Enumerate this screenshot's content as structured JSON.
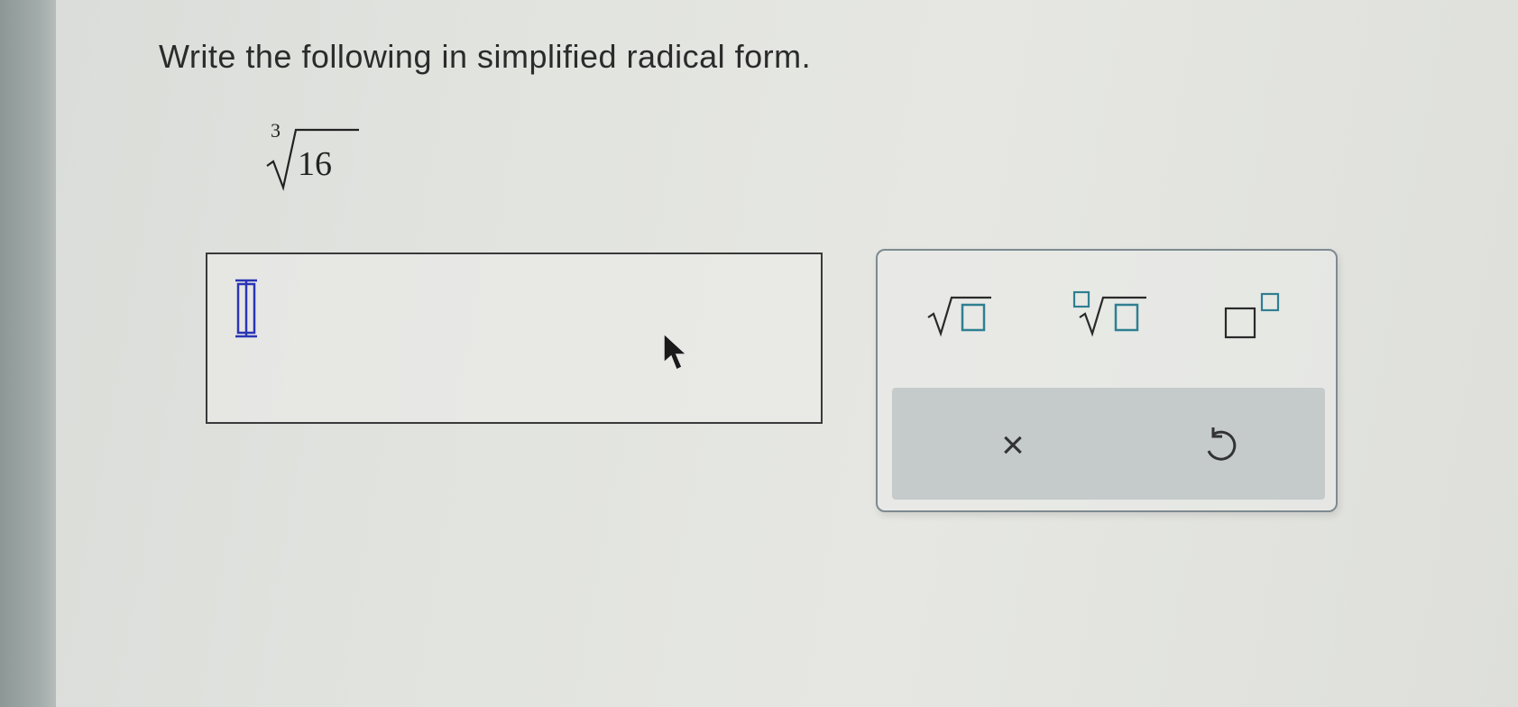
{
  "question": {
    "prompt": "Write the following in simplified radical form.",
    "expression": {
      "index": "3",
      "radicand": "16"
    }
  },
  "answer": {
    "value": ""
  },
  "palette": {
    "tools": [
      "square-root-icon",
      "nth-root-icon",
      "superscript-icon"
    ],
    "actions": {
      "clear_label": "×",
      "undo_icon": "undo-icon"
    }
  },
  "colors": {
    "caret": "#2a35b5",
    "palette_border": "#7e8a90",
    "icon_stroke": "#2f7f91",
    "action_bar": "#c5cacb"
  }
}
